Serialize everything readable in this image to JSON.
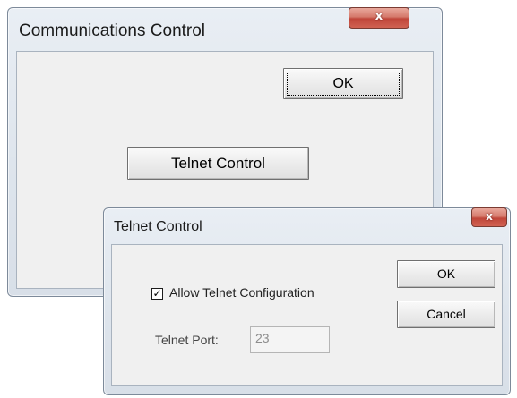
{
  "comm_window": {
    "title": "Communications Control",
    "close_glyph": "x",
    "ok_label": "OK",
    "telnet_button_label": "Telnet Control"
  },
  "telnet_window": {
    "title": "Telnet Control",
    "close_glyph": "x",
    "allow_checkbox": {
      "label": "Allow Telnet Configuration",
      "checked": true,
      "glyph": "✓"
    },
    "port_label": "Telnet Port:",
    "port_value": "23",
    "ok_label": "OK",
    "cancel_label": "Cancel"
  }
}
